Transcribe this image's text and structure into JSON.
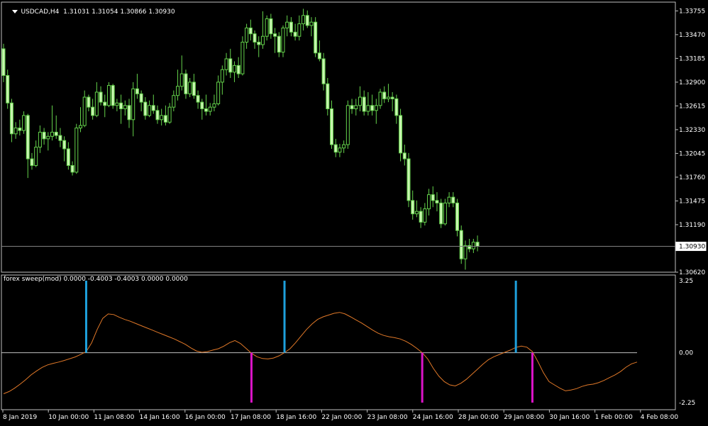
{
  "header": {
    "symbol": "USDCAD,H4",
    "ohlc": "1.31031 1.31054 1.30866 1.30930"
  },
  "indicator": {
    "label": "forex sweep(mod) 0.0000 -0.4003 -0.4003 0.0000 0.0000"
  },
  "colors": {
    "background": "#000000",
    "bull": "#000000",
    "bear": "#c8f5b0",
    "wick": "#64d24b",
    "axis": "#c0c0c0",
    "current_price_line": "#808080",
    "oscillator": "#e07828",
    "buy_signal": "#1ea0dc",
    "sell_signal": "#dc14c8"
  },
  "icons": [
    "dropdown-triangle-icon"
  ],
  "price_axis": {
    "labels": [
      "1.33755",
      "1.33470",
      "1.33185",
      "1.32900",
      "1.32615",
      "1.32330",
      "1.32045",
      "1.31760",
      "1.31475",
      "1.31190",
      "1.30620"
    ],
    "current_price": "1.30930"
  },
  "indicator_axis": {
    "labels": [
      "3.25",
      "0.00",
      "-2.25"
    ]
  },
  "time_axis": {
    "labels": [
      "8 Jan 2019",
      "10 Jan 00:00",
      "11 Jan 08:00",
      "14 Jan 16:00",
      "16 Jan 00:00",
      "17 Jan 08:00",
      "18 Jan 16:00",
      "22 Jan 00:00",
      "23 Jan 08:00",
      "24 Jan 16:00",
      "28 Jan 00:00",
      "29 Jan 08:00",
      "30 Jan 16:00",
      "1 Feb 00:00",
      "4 Feb 08:00"
    ]
  },
  "chart_data": [
    {
      "type": "candlestick",
      "title": "USDCAD,H4",
      "ylim": [
        1.3062,
        1.3386
      ],
      "ohlc": [
        [
          1.333,
          1.3336,
          1.329,
          1.3298
        ],
        [
          1.3298,
          1.3305,
          1.3258,
          1.3265
        ],
        [
          1.3265,
          1.327,
          1.3218,
          1.3228
        ],
        [
          1.3228,
          1.3242,
          1.3222,
          1.3235
        ],
        [
          1.3235,
          1.3245,
          1.3226,
          1.3232
        ],
        [
          1.3232,
          1.3255,
          1.3228,
          1.325
        ],
        [
          1.325,
          1.3252,
          1.3175,
          1.3198
        ],
        [
          1.3198,
          1.3205,
          1.3185,
          1.319
        ],
        [
          1.319,
          1.322,
          1.3188,
          1.3212
        ],
        [
          1.3212,
          1.3238,
          1.3205,
          1.323
        ],
        [
          1.323,
          1.3235,
          1.3215,
          1.3222
        ],
        [
          1.3222,
          1.323,
          1.3208,
          1.3225
        ],
        [
          1.3225,
          1.3262,
          1.322,
          1.323
        ],
        [
          1.323,
          1.325,
          1.3222,
          1.3226
        ],
        [
          1.3226,
          1.3235,
          1.3212,
          1.322
        ],
        [
          1.322,
          1.3225,
          1.3195,
          1.321
        ],
        [
          1.321,
          1.3218,
          1.3185,
          1.319
        ],
        [
          1.319,
          1.3195,
          1.3178,
          1.3182
        ],
        [
          1.3182,
          1.324,
          1.318,
          1.3235
        ],
        [
          1.3235,
          1.326,
          1.323,
          1.3238
        ],
        [
          1.3238,
          1.328,
          1.3236,
          1.3272
        ],
        [
          1.3272,
          1.3275,
          1.3255,
          1.326
        ],
        [
          1.326,
          1.327,
          1.3245,
          1.325
        ],
        [
          1.325,
          1.329,
          1.3248,
          1.3278
        ],
        [
          1.3278,
          1.3285,
          1.3262,
          1.3266
        ],
        [
          1.3266,
          1.3275,
          1.3248,
          1.3262
        ],
        [
          1.3262,
          1.329,
          1.326,
          1.3286
        ],
        [
          1.3286,
          1.3288,
          1.3258,
          1.3262
        ],
        [
          1.3262,
          1.327,
          1.3255,
          1.3265
        ],
        [
          1.3265,
          1.3275,
          1.324,
          1.3258
        ],
        [
          1.3258,
          1.3268,
          1.325,
          1.3262
        ],
        [
          1.3262,
          1.327,
          1.3235,
          1.3245
        ],
        [
          1.3245,
          1.329,
          1.3225,
          1.3282
        ],
        [
          1.3282,
          1.33,
          1.327,
          1.3276
        ],
        [
          1.3276,
          1.328,
          1.3255,
          1.3266
        ],
        [
          1.3266,
          1.3272,
          1.3245,
          1.325
        ],
        [
          1.325,
          1.3268,
          1.3248,
          1.3262
        ],
        [
          1.3262,
          1.3275,
          1.3252,
          1.3256
        ],
        [
          1.3256,
          1.3262,
          1.324,
          1.3245
        ],
        [
          1.3245,
          1.3258,
          1.3238,
          1.325
        ],
        [
          1.325,
          1.3262,
          1.3238,
          1.3242
        ],
        [
          1.3242,
          1.3265,
          1.324,
          1.326
        ],
        [
          1.326,
          1.328,
          1.3255,
          1.3274
        ],
        [
          1.3274,
          1.3305,
          1.3268,
          1.3285
        ],
        [
          1.3285,
          1.3322,
          1.328,
          1.33
        ],
        [
          1.33,
          1.3305,
          1.327,
          1.3276
        ],
        [
          1.3276,
          1.3295,
          1.3272,
          1.329
        ],
        [
          1.329,
          1.33,
          1.327,
          1.3274
        ],
        [
          1.3274,
          1.328,
          1.3258,
          1.3266
        ],
        [
          1.3266,
          1.327,
          1.3245,
          1.3258
        ],
        [
          1.3258,
          1.3275,
          1.325,
          1.3255
        ],
        [
          1.3255,
          1.3265,
          1.325,
          1.326
        ],
        [
          1.326,
          1.3275,
          1.3255,
          1.3264
        ],
        [
          1.3264,
          1.3298,
          1.3262,
          1.329
        ],
        [
          1.329,
          1.331,
          1.3275,
          1.3305
        ],
        [
          1.3305,
          1.3325,
          1.3298,
          1.3318
        ],
        [
          1.3318,
          1.333,
          1.3295,
          1.3302
        ],
        [
          1.3302,
          1.3315,
          1.329,
          1.331
        ],
        [
          1.331,
          1.332,
          1.3295,
          1.33
        ],
        [
          1.33,
          1.3345,
          1.3298,
          1.3338
        ],
        [
          1.3338,
          1.336,
          1.333,
          1.3355
        ],
        [
          1.3355,
          1.3365,
          1.334,
          1.3348
        ],
        [
          1.3348,
          1.3352,
          1.333,
          1.3338
        ],
        [
          1.3338,
          1.3345,
          1.332,
          1.3335
        ],
        [
          1.3335,
          1.3375,
          1.333,
          1.3345
        ],
        [
          1.3345,
          1.337,
          1.334,
          1.3366
        ],
        [
          1.3366,
          1.3372,
          1.3342,
          1.3348
        ],
        [
          1.3348,
          1.3355,
          1.3325,
          1.3345
        ],
        [
          1.3345,
          1.335,
          1.332,
          1.3326
        ],
        [
          1.3326,
          1.3358,
          1.332,
          1.3355
        ],
        [
          1.3355,
          1.337,
          1.3345,
          1.3362
        ],
        [
          1.3362,
          1.3368,
          1.3345,
          1.335
        ],
        [
          1.335,
          1.336,
          1.334,
          1.3345
        ],
        [
          1.3345,
          1.337,
          1.334,
          1.336
        ],
        [
          1.336,
          1.3378,
          1.3352,
          1.337
        ],
        [
          1.337,
          1.3376,
          1.3355,
          1.3358
        ],
        [
          1.3358,
          1.3368,
          1.3345,
          1.3362
        ],
        [
          1.3362,
          1.3368,
          1.332,
          1.3325
        ],
        [
          1.3325,
          1.334,
          1.3315,
          1.3318
        ],
        [
          1.3318,
          1.3325,
          1.328,
          1.3288
        ],
        [
          1.3288,
          1.3295,
          1.325,
          1.3258
        ],
        [
          1.3258,
          1.3268,
          1.321,
          1.3215
        ],
        [
          1.3215,
          1.3222,
          1.32,
          1.3206
        ],
        [
          1.3206,
          1.3216,
          1.32,
          1.3211
        ],
        [
          1.3211,
          1.322,
          1.3205,
          1.3215
        ],
        [
          1.3215,
          1.3268,
          1.321,
          1.3262
        ],
        [
          1.3262,
          1.327,
          1.3252,
          1.3258
        ],
        [
          1.3258,
          1.327,
          1.325,
          1.3262
        ],
        [
          1.3262,
          1.3285,
          1.3255,
          1.3272
        ],
        [
          1.3272,
          1.328,
          1.325,
          1.3255
        ],
        [
          1.3255,
          1.3278,
          1.325,
          1.3262
        ],
        [
          1.3262,
          1.3275,
          1.325,
          1.3256
        ],
        [
          1.3256,
          1.327,
          1.324,
          1.3262
        ],
        [
          1.3262,
          1.3282,
          1.3258,
          1.3278
        ],
        [
          1.3278,
          1.3285,
          1.3265,
          1.327
        ],
        [
          1.327,
          1.3288,
          1.3266,
          1.3272
        ],
        [
          1.3272,
          1.3278,
          1.3255,
          1.327
        ],
        [
          1.327,
          1.3275,
          1.324,
          1.325
        ],
        [
          1.325,
          1.3258,
          1.3195,
          1.3205
        ],
        [
          1.3205,
          1.3215,
          1.319,
          1.3198
        ],
        [
          1.3198,
          1.3205,
          1.314,
          1.3148
        ],
        [
          1.3148,
          1.316,
          1.3125,
          1.3132
        ],
        [
          1.3132,
          1.3148,
          1.3128,
          1.3135
        ],
        [
          1.3135,
          1.314,
          1.3115,
          1.3122
        ],
        [
          1.3122,
          1.3145,
          1.3118,
          1.3138
        ],
        [
          1.3138,
          1.3162,
          1.313,
          1.3155
        ],
        [
          1.3155,
          1.3165,
          1.314,
          1.3148
        ],
        [
          1.3148,
          1.3158,
          1.3135,
          1.3145
        ],
        [
          1.3145,
          1.315,
          1.3115,
          1.312
        ],
        [
          1.312,
          1.315,
          1.3118,
          1.3145
        ],
        [
          1.3145,
          1.3158,
          1.314,
          1.3152
        ],
        [
          1.3152,
          1.3158,
          1.314,
          1.3145
        ],
        [
          1.3145,
          1.315,
          1.3105,
          1.3112
        ],
        [
          1.3112,
          1.3118,
          1.3072,
          1.3078
        ],
        [
          1.3078,
          1.31,
          1.3065,
          1.3094
        ],
        [
          1.3094,
          1.3102,
          1.3086,
          1.309
        ],
        [
          1.309,
          1.3102,
          1.3085,
          1.3098
        ],
        [
          1.3098,
          1.3106,
          1.3087,
          1.3093
        ]
      ]
    },
    {
      "type": "line",
      "title": "forex sweep(mod)",
      "ylim": [
        -2.25,
        3.25
      ],
      "zero_line": 0.0,
      "values": [
        -1.85,
        -1.75,
        -1.6,
        -1.42,
        -1.22,
        -1.0,
        -0.82,
        -0.66,
        -0.55,
        -0.48,
        -0.42,
        -0.35,
        -0.27,
        -0.19,
        -0.08,
        0.05,
        0.45,
        1.05,
        1.55,
        1.75,
        1.72,
        1.6,
        1.5,
        1.42,
        1.32,
        1.22,
        1.12,
        1.02,
        0.92,
        0.82,
        0.72,
        0.62,
        0.5,
        0.38,
        0.22,
        0.08,
        0.02,
        0.05,
        0.12,
        0.18,
        0.3,
        0.45,
        0.55,
        0.42,
        0.2,
        -0.02,
        -0.18,
        -0.26,
        -0.28,
        -0.24,
        -0.14,
        0.0,
        0.18,
        0.45,
        0.75,
        1.05,
        1.3,
        1.5,
        1.62,
        1.7,
        1.78,
        1.82,
        1.75,
        1.62,
        1.48,
        1.34,
        1.18,
        1.02,
        0.88,
        0.78,
        0.72,
        0.68,
        0.62,
        0.52,
        0.38,
        0.2,
        0.0,
        -0.28,
        -0.7,
        -1.05,
        -1.3,
        -1.45,
        -1.5,
        -1.38,
        -1.2,
        -0.98,
        -0.75,
        -0.52,
        -0.32,
        -0.18,
        -0.08,
        0.02,
        0.12,
        0.24,
        0.3,
        0.25,
        0.05,
        -0.4,
        -0.9,
        -1.3,
        -1.45,
        -1.6,
        -1.72,
        -1.68,
        -1.62,
        -1.52,
        -1.45,
        -1.42,
        -1.35,
        -1.25,
        -1.12,
        -1.0,
        -0.85,
        -0.65,
        -0.5,
        -0.42
      ],
      "buy_signals": [
        15,
        51,
        93
      ],
      "sell_signals": [
        45,
        76,
        96
      ]
    }
  ]
}
